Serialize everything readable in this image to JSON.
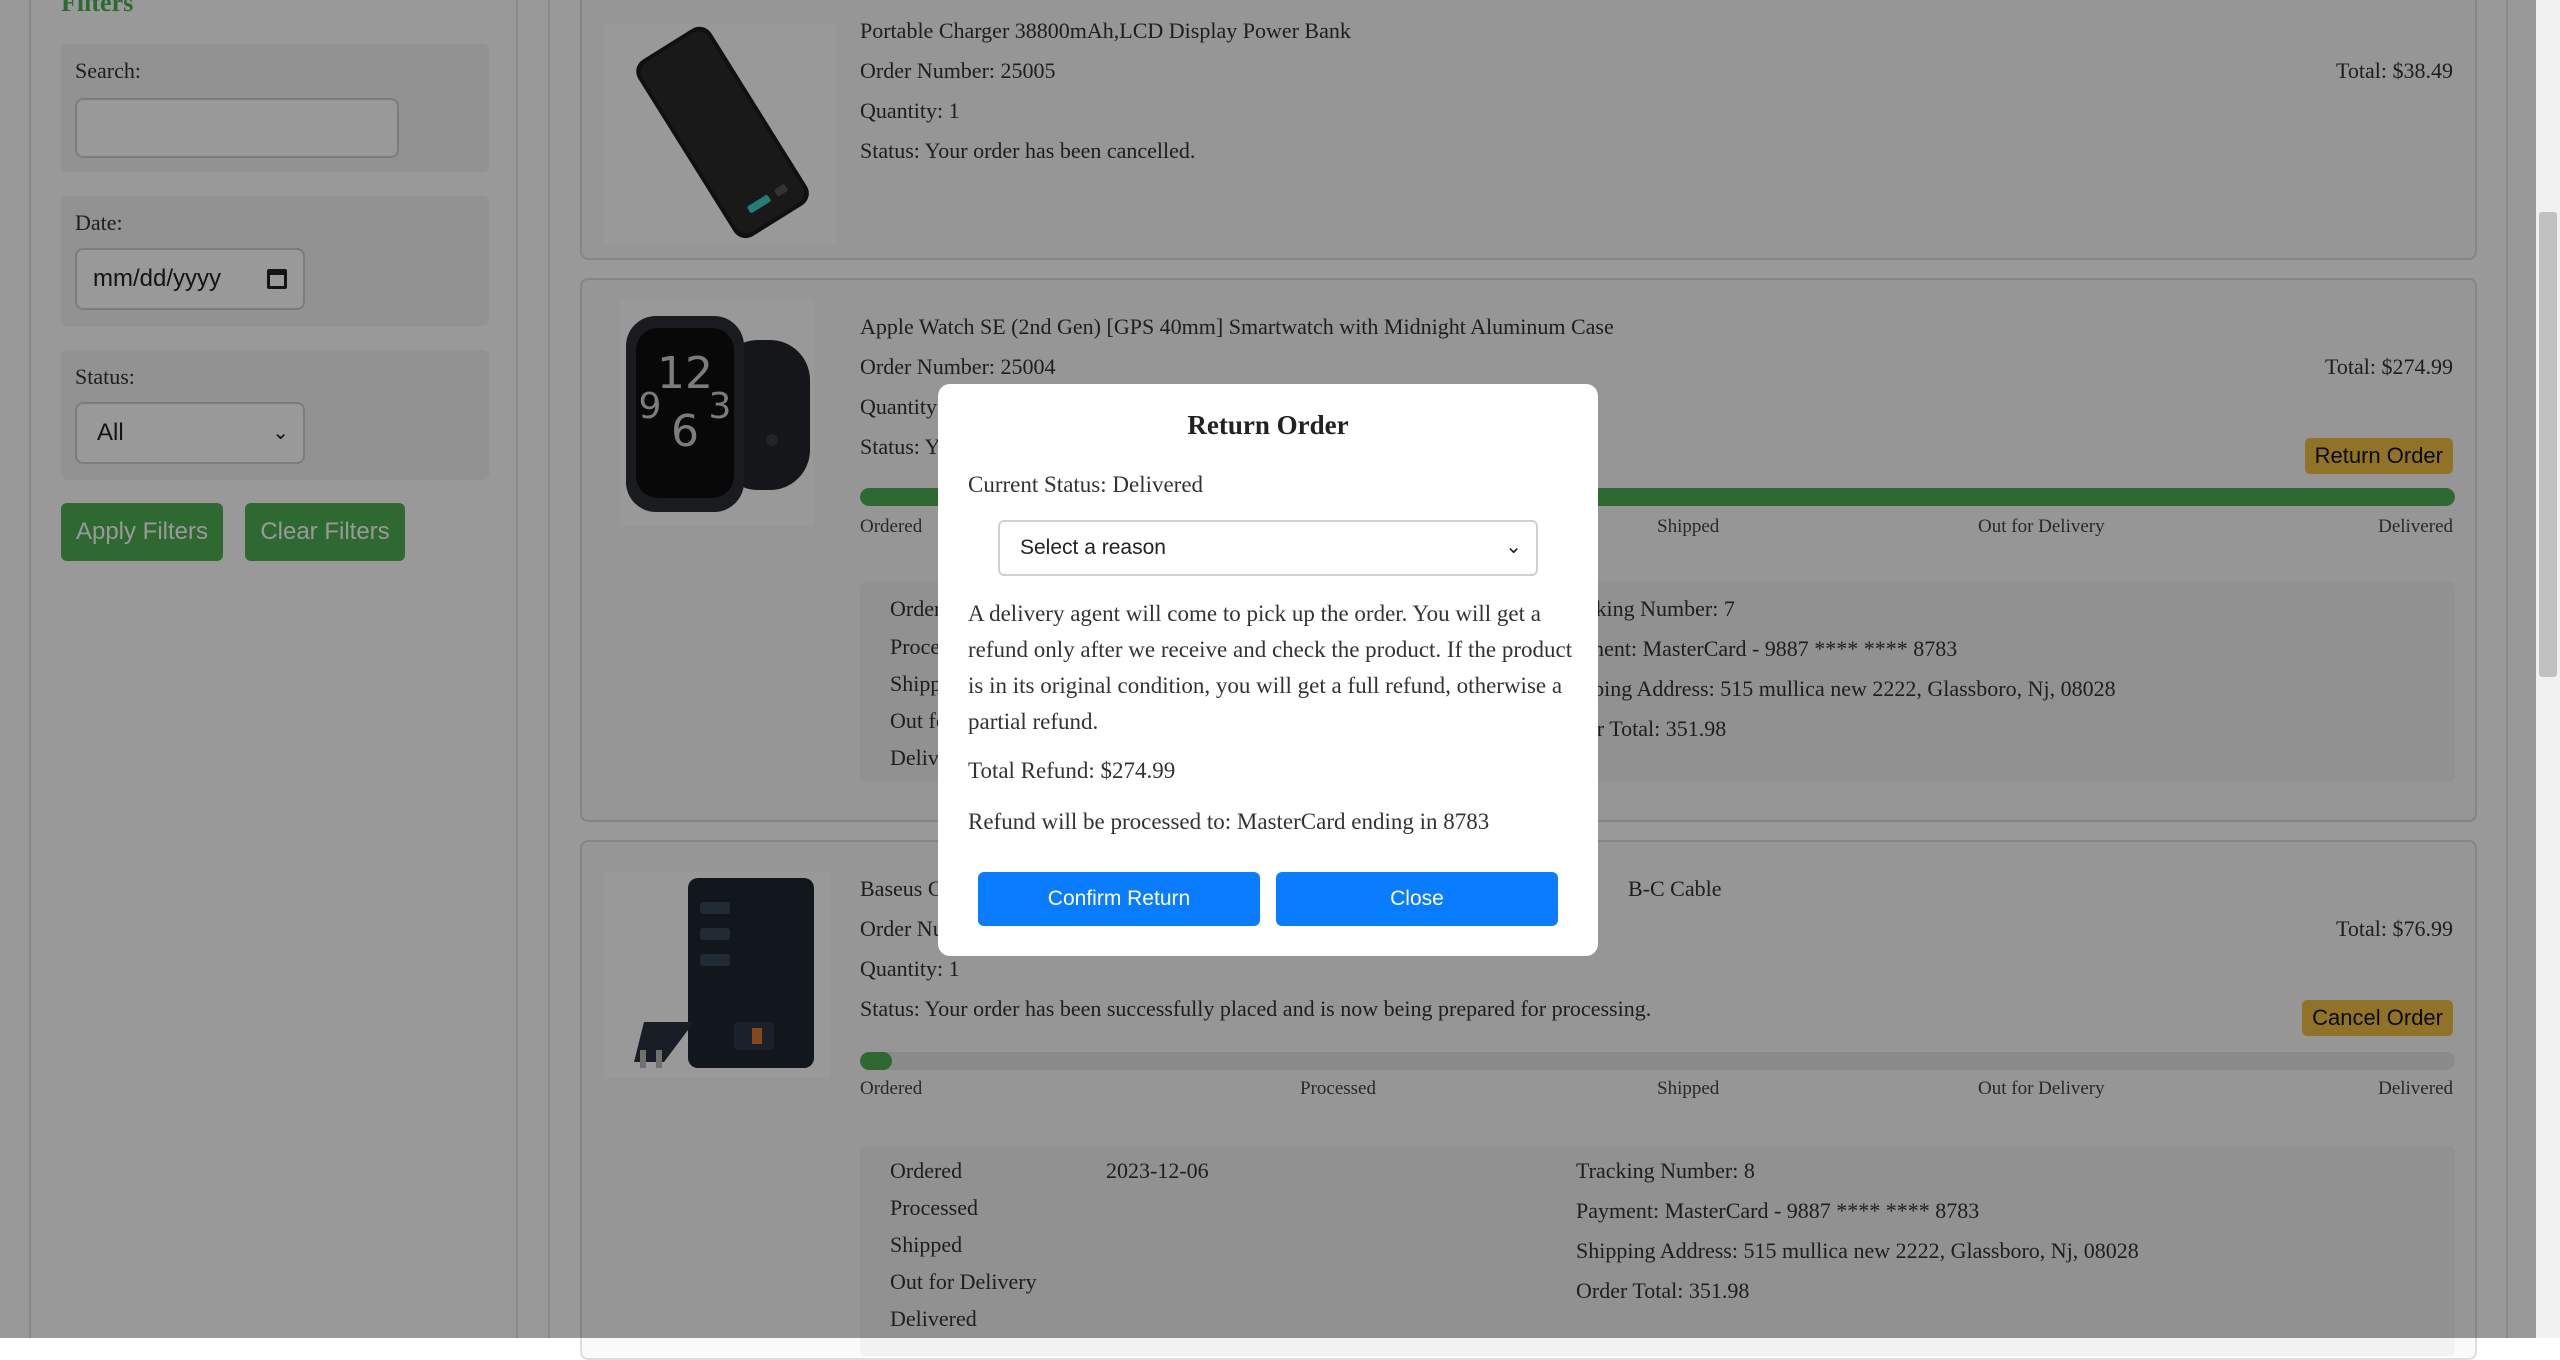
{
  "sidebar": {
    "title": "Filters",
    "search_label": "Search:",
    "date_label": "Date:",
    "date_placeholder": "mm/dd/yyyy",
    "status_label": "Status:",
    "status_value": "All",
    "apply_label": "Apply Filters",
    "clear_label": "Clear Filters"
  },
  "orders": [
    {
      "name": "Portable Charger 38800mAh,LCD Display Power Bank",
      "order_number": "Order Number: 25005",
      "quantity": "Quantity: 1",
      "status": "Status: Your order has been cancelled.",
      "total": "Total: $38.49"
    },
    {
      "name": "Apple Watch SE (2nd Gen) [GPS 40mm] Smartwatch with Midnight Aluminum Case",
      "order_number": "Order Number: 25004",
      "quantity": "Quantity:",
      "status": "Status: Yo",
      "total": "Total: $274.99",
      "action": "Return Order",
      "progress": 1.0,
      "stages": [
        "Ordered",
        "Shipped",
        "Out for Delivery",
        "Delivered"
      ],
      "detail_left": [
        "Order",
        "Proce",
        "Shipp",
        "Out fo",
        "Delive"
      ],
      "tracking": "acking Number: 7",
      "payment": "yment: MasterCard - 9887 **** **** 8783",
      "address": "ipping Address: 515 mullica new 2222, Glassboro, Nj, 08028",
      "order_total": "der Total: 351.98"
    },
    {
      "name_left": "Baseus C",
      "name_right": "B-C Cable",
      "order_number": "Order Nu",
      "quantity": "Quantity: 1",
      "status": "Status: Your order has been successfully placed and is now being prepared for processing.",
      "total": "Total: $76.99",
      "action": "Cancel Order",
      "progress": 0.02,
      "stages": [
        "Ordered",
        "Processed",
        "Shipped",
        "Out for Delivery",
        "Delivered"
      ],
      "detail_left": [
        "Ordered",
        "Processed",
        "Shipped",
        "Out for Delivery",
        "Delivered"
      ],
      "ordered_date": "2023-12-06",
      "tracking": "Tracking Number: 8",
      "payment": "Payment: MasterCard - 9887 **** **** 8783",
      "address": "Shipping Address: 515 mullica new 2222, Glassboro, Nj, 08028",
      "order_total": "Order Total: 351.98"
    }
  ],
  "modal": {
    "title": "Return Order",
    "current_status": "Current Status: Delivered",
    "reason_placeholder": "Select a reason",
    "description": "A delivery agent will come to pick up the order. You will get a refund only after we receive and check the product. If the product is in its original condition, you will get a full refund, otherwise a partial refund.",
    "total_refund": "Total Refund: $274.99",
    "refund_to": "Refund will be processed to: MasterCard ending in 8783",
    "confirm_label": "Confirm Return",
    "close_label": "Close"
  },
  "colors": {
    "green": "#4caf50",
    "blue": "#0a7cff",
    "yellow": "#f0c040"
  }
}
